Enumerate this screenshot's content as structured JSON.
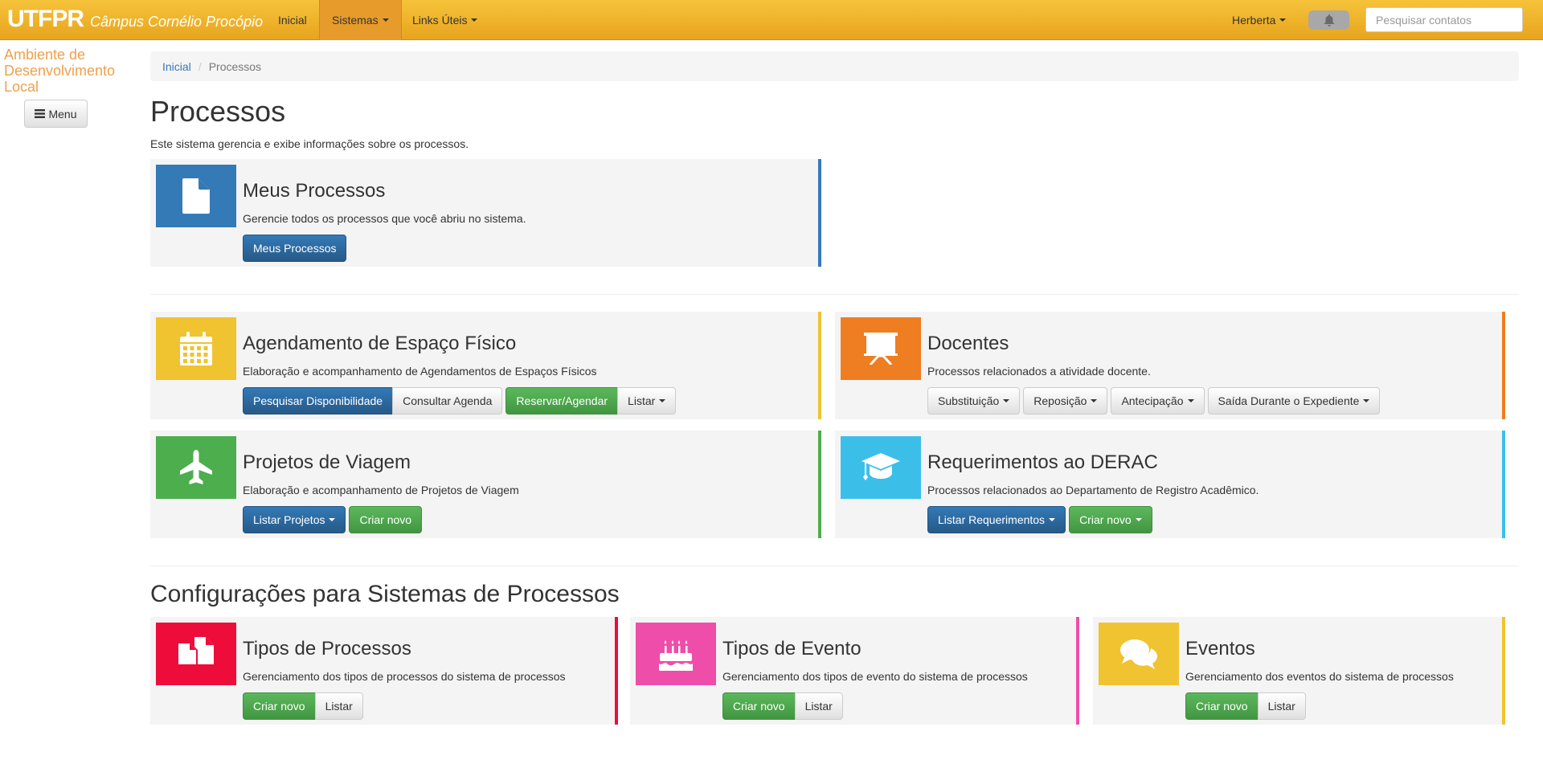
{
  "navbar": {
    "brand_logo": "UTFPR",
    "brand_campus": "Câmpus Cornélio Procópio",
    "items": [
      {
        "label": "Inicial"
      },
      {
        "label": "Sistemas"
      },
      {
        "label": "Links Úteis"
      }
    ],
    "user": "Herberta",
    "search_placeholder": "Pesquisar contatos"
  },
  "sidebar": {
    "title": "Ambiente de Desenvolvimento Local",
    "menu_label": "Menu"
  },
  "breadcrumb": {
    "home": "Inicial",
    "current": "Processos"
  },
  "page": {
    "title": "Processos",
    "description": "Este sistema gerencia e exibe informações sobre os processos.",
    "section_title": "Configurações para Sistemas de Processos"
  },
  "cards": [
    {
      "title": "Meus Processos",
      "description": "Gerencie todos os processos que você abriu no sistema.",
      "color": "#337ab7",
      "icon": "file-icon",
      "buttons": [
        {
          "label": "Meus Processos"
        }
      ]
    },
    {
      "title": "Agendamento de Espaço Físico",
      "description": "Elaboração e acompanhamento de Agendamentos de Espaços Físicos",
      "color": "#f0c330",
      "icon": "calendar-icon",
      "buttons": [
        {
          "label": "Pesquisar Disponibilidade"
        },
        {
          "label": "Consultar Agenda"
        },
        {
          "label": "Reservar/Agendar"
        },
        {
          "label": "Listar"
        }
      ]
    },
    {
      "title": "Docentes",
      "description": "Processos relacionados a atividade docente.",
      "color": "#ef7d22",
      "icon": "presentation-icon",
      "buttons": [
        {
          "label": "Substituição"
        },
        {
          "label": "Reposição"
        },
        {
          "label": "Antecipação"
        },
        {
          "label": "Saída Durante o Expediente"
        }
      ]
    },
    {
      "title": "Projetos de Viagem",
      "description": "Elaboração e acompanhamento de Projetos de Viagem",
      "color": "#4cae4c",
      "icon": "plane-icon",
      "buttons": [
        {
          "label": "Listar Projetos"
        },
        {
          "label": "Criar novo"
        }
      ]
    },
    {
      "title": "Requerimentos ao DERAC",
      "description": "Processos relacionados ao Departamento de Registro Acadêmico.",
      "color": "#3bbfe9",
      "icon": "graduation-cap-icon",
      "buttons": [
        {
          "label": "Listar Requerimentos"
        },
        {
          "label": "Criar novo"
        }
      ]
    },
    {
      "title": "Tipos de Processos",
      "description": "Gerenciamento dos tipos de processos do sistema de processos",
      "color": "#ed0c3a",
      "icon": "files-icon",
      "buttons": [
        {
          "label": "Criar novo"
        },
        {
          "label": "Listar"
        }
      ]
    },
    {
      "title": "Tipos de Evento",
      "description": "Gerenciamento dos tipos de evento do sistema de processos",
      "color": "#ee4ea9",
      "icon": "cake-icon",
      "buttons": [
        {
          "label": "Criar novo"
        },
        {
          "label": "Listar"
        }
      ]
    },
    {
      "title": "Eventos",
      "description": "Gerenciamento dos eventos do sistema de processos",
      "color": "#f0c330",
      "icon": "comments-icon",
      "buttons": [
        {
          "label": "Criar novo"
        },
        {
          "label": "Listar"
        }
      ]
    }
  ]
}
